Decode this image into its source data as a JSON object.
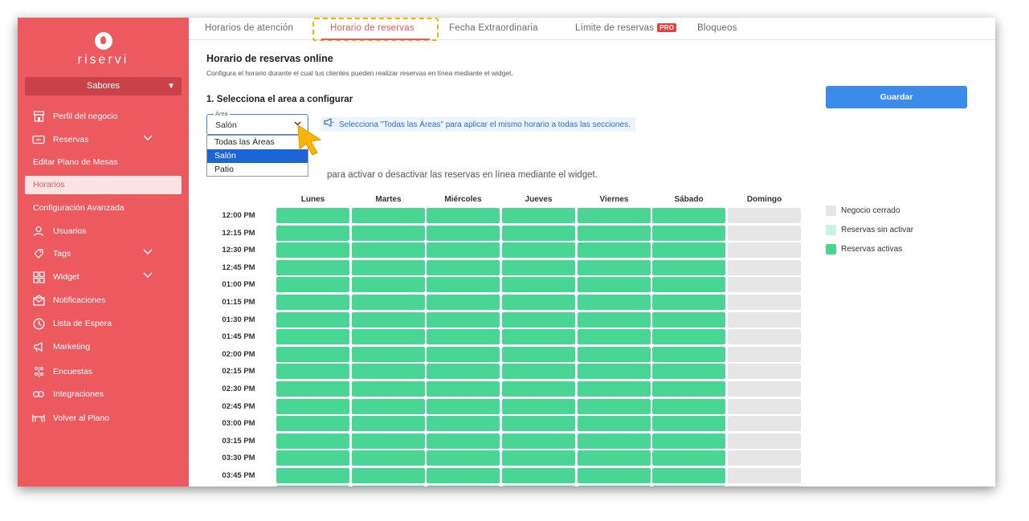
{
  "app": {
    "brand": "riservi",
    "business_selector": "Sabores"
  },
  "sidebar": {
    "items": [
      {
        "label": "Perfil del negocio",
        "icon": "store-icon"
      },
      {
        "label": "Reservas",
        "icon": "ticket-icon",
        "expandable": true
      },
      {
        "label": "Editar Plano de Mesas"
      },
      {
        "label": "Horarios",
        "active": true
      },
      {
        "label": "Configuración Avanzada"
      },
      {
        "label": "Usuarios",
        "icon": "user-icon"
      },
      {
        "label": "Tags",
        "icon": "tag-icon",
        "expandable": true
      },
      {
        "label": "Widget",
        "icon": "grid-icon",
        "expandable": true
      },
      {
        "label": "Notificaciones",
        "icon": "envelope-icon"
      },
      {
        "label": "Lista de Espera",
        "icon": "clock-icon"
      },
      {
        "label": "Marketing",
        "icon": "megaphone-icon"
      },
      {
        "label": "Encuestas",
        "icon": "survey-icon"
      },
      {
        "label": "Integraciones",
        "icon": "integrations-icon"
      },
      {
        "label": "Volver al Plano",
        "icon": "table-plan-icon"
      }
    ]
  },
  "tabs": [
    {
      "label": "Horarios de atención"
    },
    {
      "label": "Horario de reservas",
      "active": true
    },
    {
      "label": "Fecha Extraordinaria"
    },
    {
      "label": "Límite de reservas",
      "badge": "PRO"
    },
    {
      "label": "Bloqueos"
    }
  ],
  "content": {
    "title": "Horario de reservas online",
    "subtitle": "Configura el horario durante el cual tus clientes pueden realizar reservas en línea mediante el widget.",
    "save_label": "Guardar",
    "step_title": "1. Selecciona el area a configurar",
    "area_label": "Área",
    "area_value": "Salón",
    "area_options": [
      "Todas las Áreas",
      "Salón",
      "Patio"
    ],
    "area_selected_index": 1,
    "info_note": "Selecciona \"Todas las Áreas\" para aplicar el mismo horario a todas las secciones.",
    "instruction": "para activar o desactivar las reservas en línea mediante el widget."
  },
  "schedule": {
    "days": [
      "Lunes",
      "Martes",
      "Miércoles",
      "Jueves",
      "Viernes",
      "Sábado",
      "Domingo"
    ],
    "times": [
      "12:00 PM",
      "12:15 PM",
      "12:30 PM",
      "12:45 PM",
      "01:00 PM",
      "01:15 PM",
      "01:30 PM",
      "01:45 PM",
      "02:00 PM",
      "02:15 PM",
      "02:30 PM",
      "02:45 PM",
      "03:00 PM",
      "03:15 PM",
      "03:30 PM",
      "03:45 PM"
    ],
    "day_status": [
      "active",
      "active",
      "active",
      "active",
      "active",
      "active",
      "closed"
    ]
  },
  "legend": [
    {
      "label": "Negocio cerrado",
      "color": "#e6e6e6"
    },
    {
      "label": "Reservas sin activar",
      "color": "#c8f3dc"
    },
    {
      "label": "Reservas activas",
      "color": "#49d695"
    }
  ],
  "colors": {
    "brand": "#ec5a60",
    "primary": "#3b8beb",
    "active_cell": "#49d695",
    "closed_cell": "#e6e6e6"
  }
}
